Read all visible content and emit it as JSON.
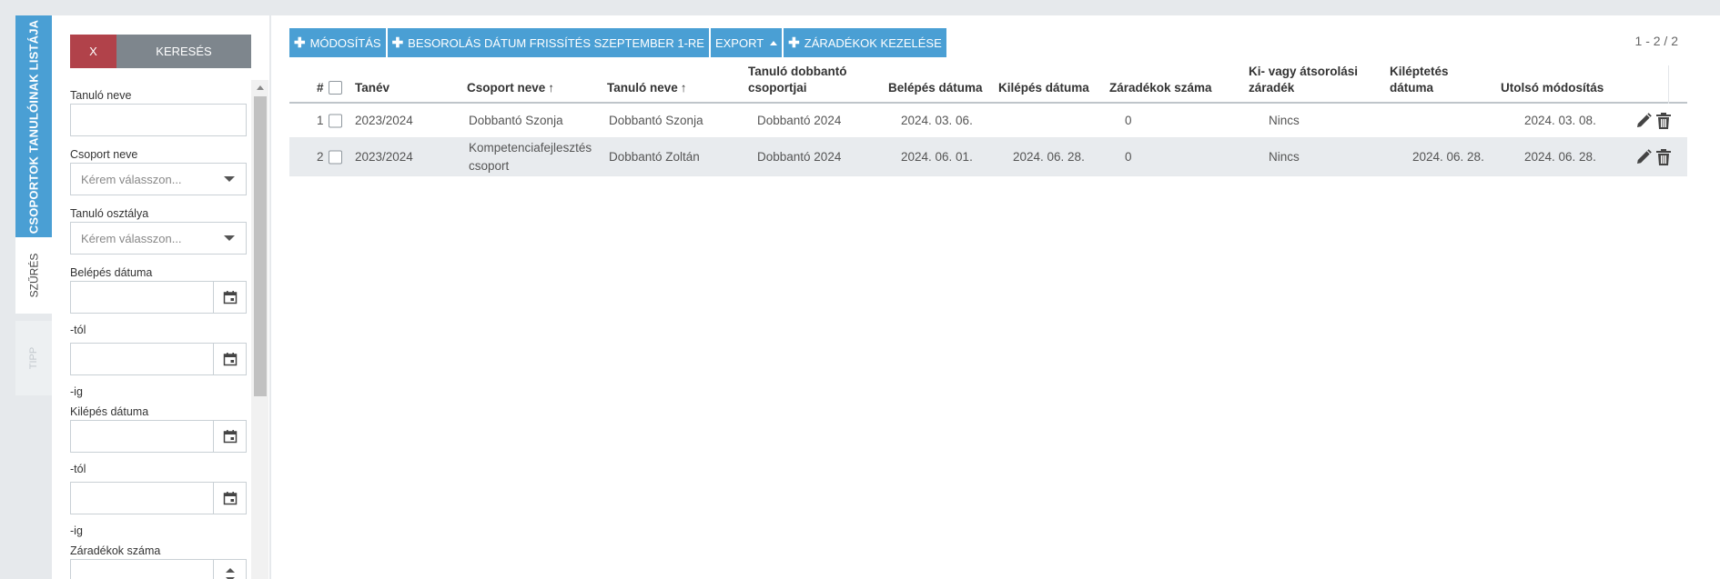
{
  "side_tabs": {
    "main_label": "CSOPORTOK TANULÓINAK LISTÁJA",
    "filter_label": "SZŰRÉS",
    "tip_label": "TIPP"
  },
  "filter": {
    "clear_label": "X",
    "search_label": "KERESÉS",
    "student_name_label": "Tanuló neve",
    "group_name_label": "Csoport neve",
    "group_name_placeholder": "Kérem válasszon...",
    "student_class_label": "Tanuló osztálya",
    "student_class_placeholder": "Kérem válasszon...",
    "entry_date_label": "Belépés dátuma",
    "from_suffix": "-tól",
    "to_suffix": "-ig",
    "exit_date_label": "Kilépés dátuma",
    "clause_count_label": "Záradékok száma"
  },
  "toolbar": {
    "modify_label": "MÓDOSÍTÁS",
    "refresh_label": "BESOROLÁS DÁTUM FRISSÍTÉS SZEPTEMBER 1-RE",
    "export_label": "EXPORT",
    "clauses_label": "ZÁRADÉKOK KEZELÉSE",
    "pager": "1 - 2 / 2"
  },
  "grid": {
    "headers": {
      "num": "#",
      "year": "Tanév",
      "group": "Csoport neve",
      "student": "Tanuló neve",
      "dobbanto_group_1": "Tanuló dobbantó",
      "dobbanto_group_2": "csoportjai",
      "entry": "Belépés dátuma",
      "exit": "Kilépés dátuma",
      "clauses": "Záradékok száma",
      "clause_type_1": "Ki- vagy átsorolási",
      "clause_type_2": "záradék",
      "leave_date_1": "Kiléptetés",
      "leave_date_2": "dátuma",
      "modified": "Utolsó módosítás"
    },
    "rows": [
      {
        "num": "1",
        "year": "2023/2024",
        "group": "Dobbantó Szonja",
        "group2": "",
        "student": "Dobbantó Szonja",
        "dobbanto_group": "Dobbantó 2024",
        "entry": "2024. 03. 06.",
        "exit": "",
        "clauses": "0",
        "clause_type": "Nincs",
        "leave_date": "",
        "modified": "2024. 03. 08."
      },
      {
        "num": "2",
        "year": "2023/2024",
        "group": "Kompetenciafejlesztés",
        "group2": "csoport",
        "student": "Dobbantó Zoltán",
        "dobbanto_group": "Dobbantó 2024",
        "entry": "2024. 06. 01.",
        "exit": "2024. 06. 28.",
        "clauses": "0",
        "clause_type": "Nincs",
        "leave_date": "2024. 06. 28.",
        "modified": "2024. 06. 28."
      }
    ]
  },
  "colors": {
    "primary": "#4a9fd4",
    "danger": "#b1424a",
    "neutral": "#7e868d",
    "background": "#e6e9ec"
  }
}
